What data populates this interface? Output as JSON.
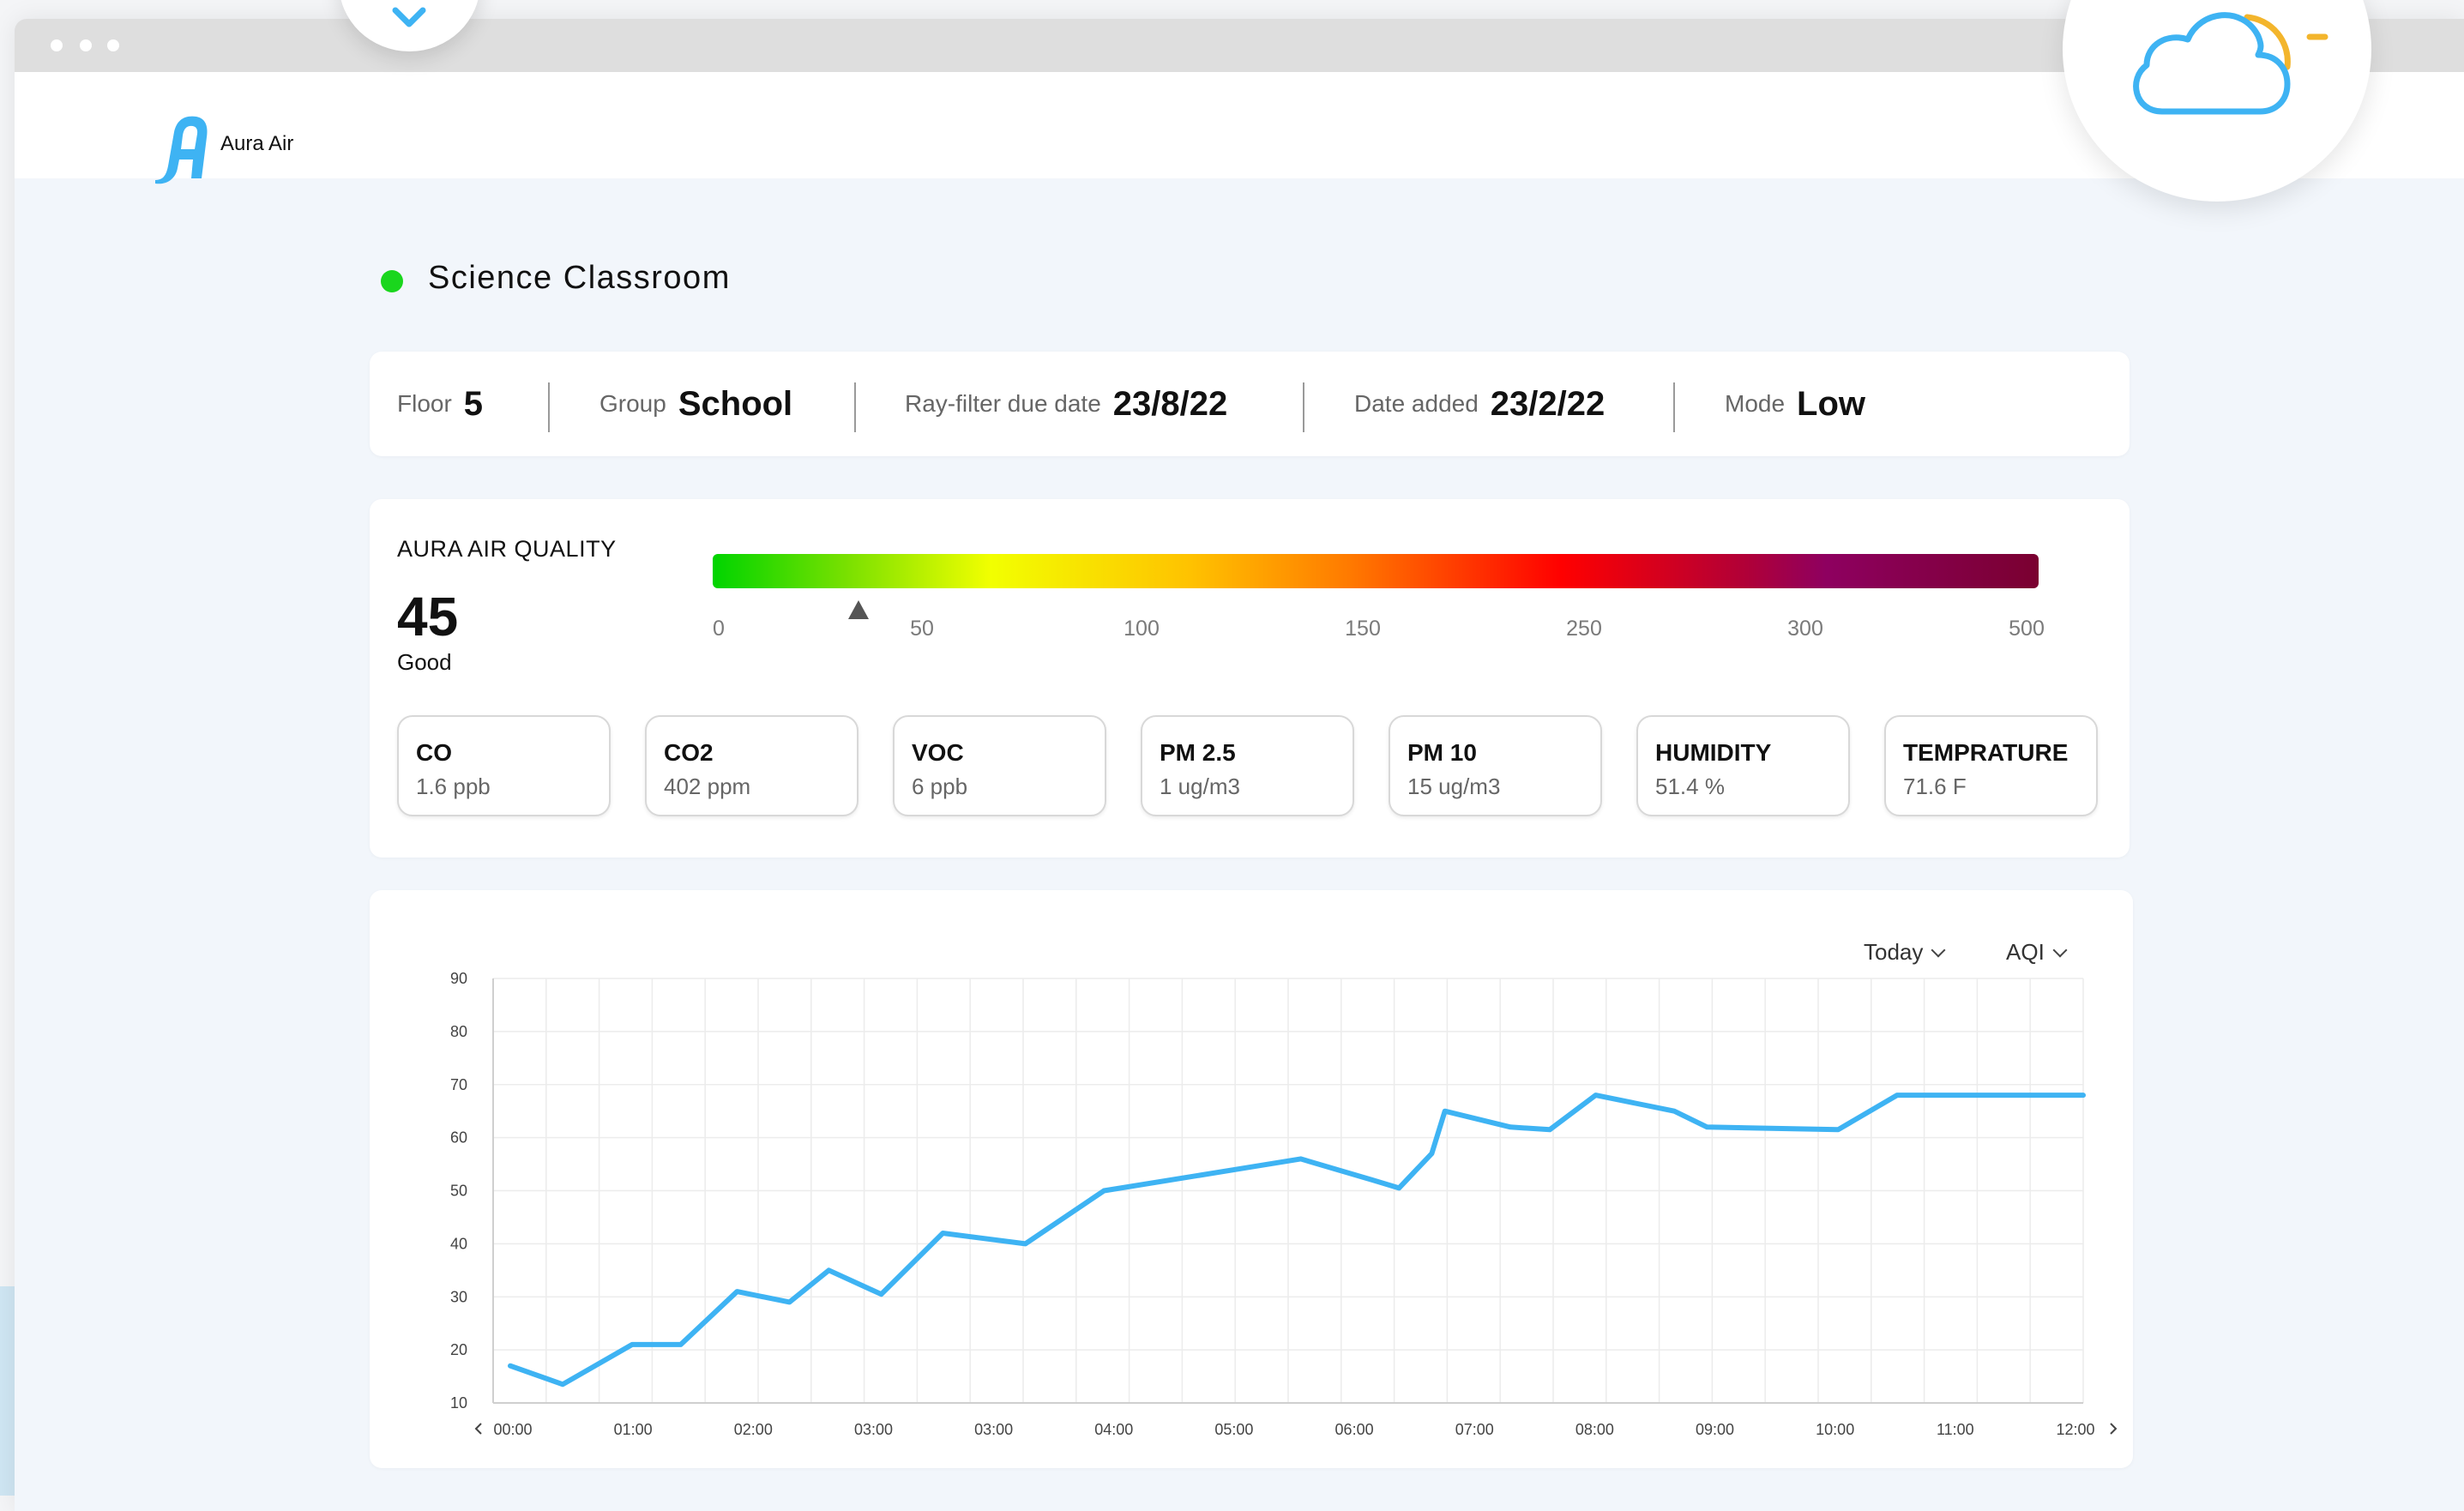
{
  "app": {
    "brand_name": "Aura Air",
    "accent": "#3eb3f3"
  },
  "device": {
    "name": "Science Classroom",
    "status_color": "#1ad61d"
  },
  "info": [
    {
      "label": "Floor",
      "value": "5"
    },
    {
      "label": "Group",
      "value": "School"
    },
    {
      "label": "Ray-filter due date",
      "value": "23/8/22"
    },
    {
      "label": "Date added",
      "value": "23/2/22"
    },
    {
      "label": "Mode",
      "value": "Low"
    }
  ],
  "aqi": {
    "title": "AURA AIR QUALITY",
    "value": "45",
    "status": "Good",
    "scale_ticks": [
      "0",
      "50",
      "100",
      "150",
      "250",
      "300",
      "500"
    ],
    "pointer_fraction": 0.11
  },
  "metrics": [
    {
      "name": "CO",
      "value": "1.6 ppb"
    },
    {
      "name": "CO2",
      "value": "402 ppm"
    },
    {
      "name": "VOC",
      "value": "6 ppb"
    },
    {
      "name": "PM 2.5",
      "value": "1 ug/m3"
    },
    {
      "name": "PM 10",
      "value": "15 ug/m3"
    },
    {
      "name": "HUMIDITY",
      "value": "51.4 %"
    },
    {
      "name": "TEMPRATURE",
      "value": "71.6 F"
    }
  ],
  "chart_controls": {
    "period": "Today",
    "metric": "AQI"
  },
  "chart_data": {
    "type": "line",
    "x_tick_labels": [
      "00:00",
      "01:00",
      "02:00",
      "03:00",
      "03:00",
      "04:00",
      "05:00",
      "06:00",
      "07:00",
      "08:00",
      "09:00",
      "10:00",
      "11:00",
      "12:00"
    ],
    "y_ticks": [
      10,
      20,
      30,
      40,
      50,
      60,
      70,
      80,
      90
    ],
    "ylim": [
      10,
      90
    ],
    "xlim": [
      0,
      12
    ],
    "grid": true,
    "series": [
      {
        "color": "#3eb3f3",
        "x": [
          0,
          0.4,
          0.93,
          1.3,
          1.73,
          2.13,
          2.43,
          2.83,
          3.3,
          3.93,
          4.53,
          5.53,
          6.03,
          6.58,
          6.78,
          7.03,
          7.13,
          7.63,
          7.93,
          8.28,
          8.88,
          9.13,
          10.13,
          10.58,
          10.98,
          11.48,
          12
        ],
        "y": [
          17,
          13.5,
          21,
          21,
          31,
          29,
          35,
          30.5,
          42,
          40,
          50,
          54,
          56,
          52,
          50.5,
          57,
          65,
          62,
          61.5,
          68,
          65,
          62,
          61.5,
          68,
          68,
          68,
          68
        ]
      }
    ]
  }
}
